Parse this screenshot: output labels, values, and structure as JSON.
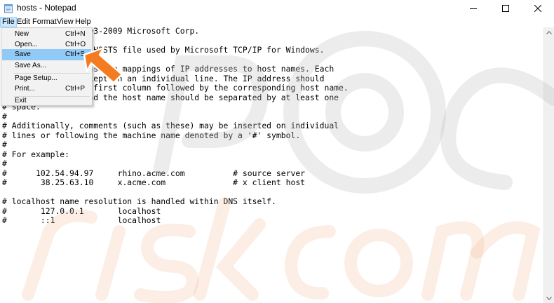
{
  "window": {
    "title": "hosts - Notepad",
    "icon": "notepad-icon"
  },
  "menubar": {
    "items": [
      {
        "label": "File",
        "active": true
      },
      {
        "label": "Edit"
      },
      {
        "label": "Format"
      },
      {
        "label": "View"
      },
      {
        "label": "Help"
      }
    ]
  },
  "file_menu": {
    "items": [
      {
        "label": "New",
        "shortcut": "Ctrl+N"
      },
      {
        "label": "Open...",
        "shortcut": "Ctrl+O"
      },
      {
        "label": "Save",
        "shortcut": "Ctrl+S",
        "highlighted": true
      },
      {
        "label": "Save As...",
        "shortcut": ""
      },
      {
        "label": "Page Setup...",
        "shortcut": ""
      },
      {
        "label": "Print...",
        "shortcut": "Ctrl+P"
      },
      {
        "label": "Exit",
        "shortcut": ""
      }
    ]
  },
  "editor": {
    "text": "# Copyright (c) 1993-2009 Microsoft Corp.\n#\n# This is a sample HOSTS file used by Microsoft TCP/IP for Windows.\n#\n# This file contains the mappings of IP addresses to host names. Each\n# entry should be kept on an individual line. The IP address should\n# be placed in the first column followed by the corresponding host name.\n# The IP address and the host name should be separated by at least one\n# space.\n#\n# Additionally, comments (such as these) may be inserted on individual\n# lines or following the machine name denoted by a '#' symbol.\n#\n# For example:\n#\n#      102.54.94.97     rhino.acme.com          # source server\n#       38.25.63.10     x.acme.com              # x client host\n\n# localhost name resolution is handled within DNS itself.\n#\t127.0.0.1       localhost\n#\t::1             localhost"
  },
  "colors": {
    "menu_highlight": "#91c9f7",
    "menubar_active": "#cce8ff",
    "arrow": "#f47b20"
  }
}
